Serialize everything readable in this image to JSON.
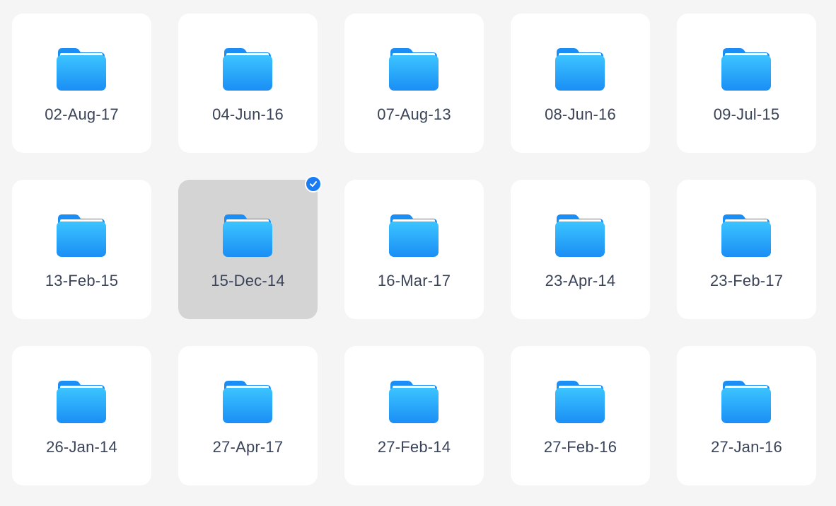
{
  "folders": [
    {
      "label": "02-Aug-17",
      "selected": false
    },
    {
      "label": "04-Jun-16",
      "selected": false
    },
    {
      "label": "07-Aug-13",
      "selected": false
    },
    {
      "label": "08-Jun-16",
      "selected": false
    },
    {
      "label": "09-Jul-15",
      "selected": false
    },
    {
      "label": "13-Feb-15",
      "selected": false
    },
    {
      "label": "15-Dec-14",
      "selected": true
    },
    {
      "label": "16-Mar-17",
      "selected": false
    },
    {
      "label": "23-Apr-14",
      "selected": false
    },
    {
      "label": "23-Feb-17",
      "selected": false
    },
    {
      "label": "26-Jan-14",
      "selected": false
    },
    {
      "label": "27-Apr-17",
      "selected": false
    },
    {
      "label": "27-Feb-14",
      "selected": false
    },
    {
      "label": "27-Feb-16",
      "selected": false
    },
    {
      "label": "27-Jan-16",
      "selected": false
    }
  ],
  "icons": {
    "folder": "folder-icon",
    "selected_marker": "checkmark-circle-icon"
  },
  "colors": {
    "folder_top": "#3cc4ff",
    "folder_bottom": "#1a8ef5",
    "selection_bg": "#d4d4d4",
    "check_bg": "#1a7cf5",
    "label_text": "#3a4358"
  }
}
